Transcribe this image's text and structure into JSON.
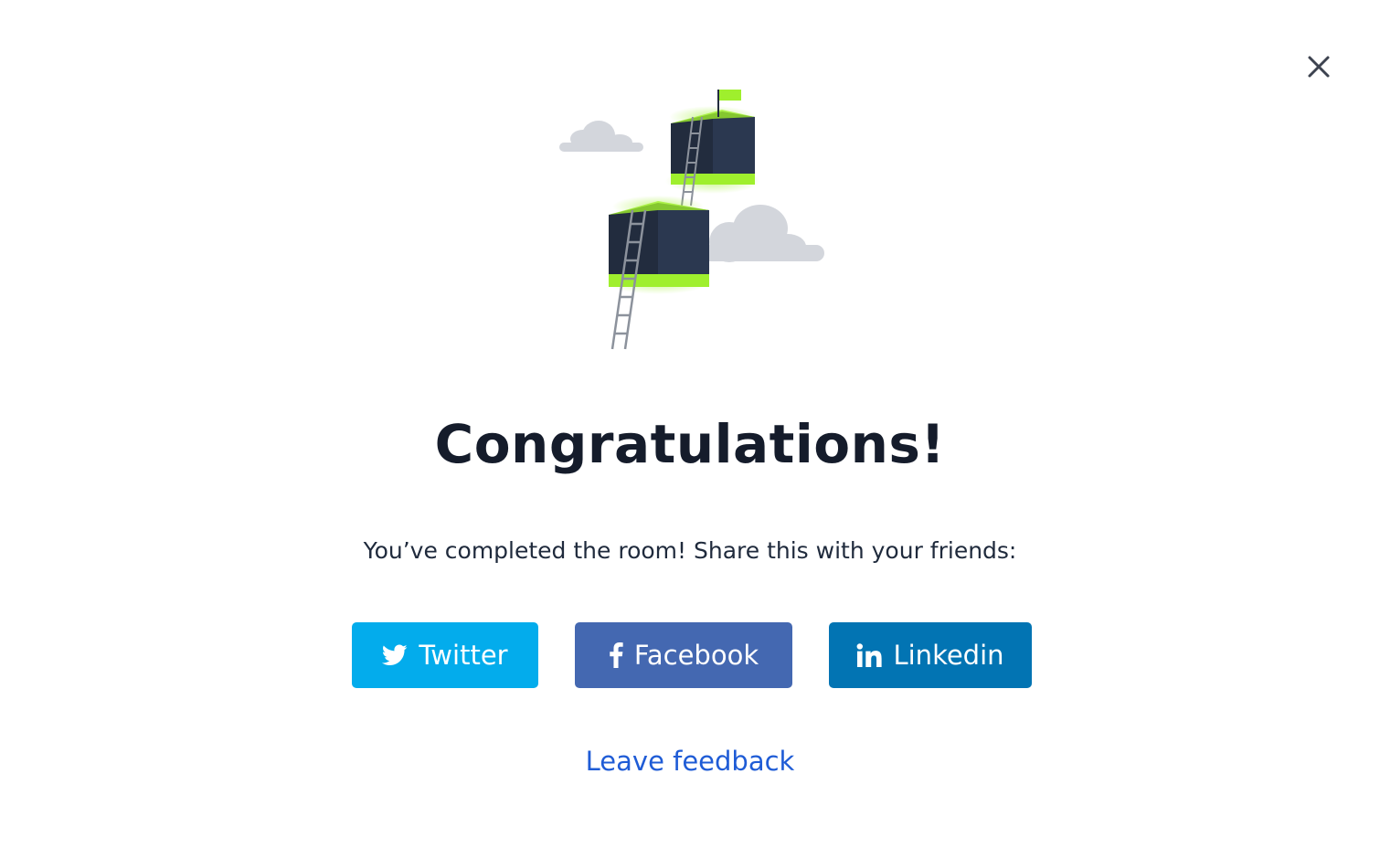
{
  "dialog": {
    "title": "Congratulations!",
    "message": "You’ve completed the room! Share this with your friends:",
    "share_buttons": [
      {
        "label": "Twitter",
        "icon": "twitter-icon",
        "color": "#03acec"
      },
      {
        "label": "Facebook",
        "icon": "facebook-icon",
        "color": "#4468b1"
      },
      {
        "label": "Linkedin",
        "icon": "linkedin-icon",
        "color": "#0274b3"
      }
    ],
    "feedback_link": "Leave feedback",
    "close_icon": "close-icon",
    "illustration": "boxes-with-ladders-and-flag-illustration"
  },
  "colors": {
    "title": "#151c2b",
    "link": "#1f5cd6",
    "accent_green": "#9fef2d",
    "box_dark": "#222c3e",
    "cloud": "#d3d6dc"
  }
}
